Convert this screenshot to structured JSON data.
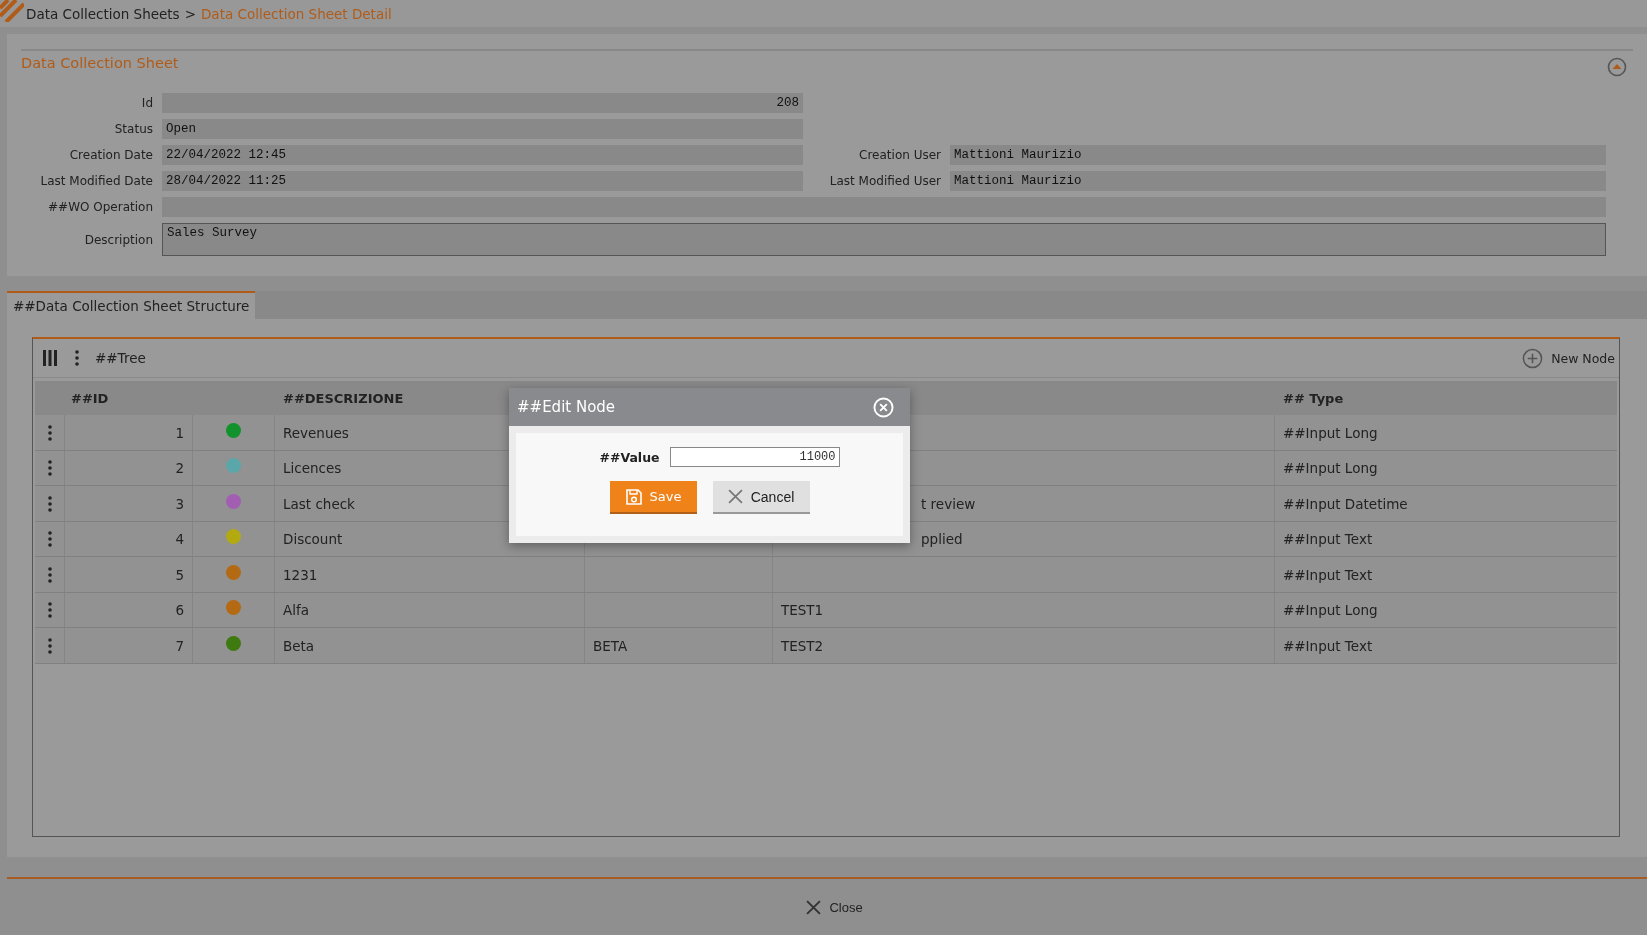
{
  "breadcrumb": [
    {
      "label": "Data Collection Sheets",
      "current": false
    },
    {
      "label": "Data Collection Sheet Detail",
      "current": true
    }
  ],
  "breadcrumb_separator": ">",
  "sheet": {
    "title": "Data Collection Sheet",
    "expanded": true,
    "rows": [
      {
        "left": {
          "label": "Id",
          "value": "208",
          "kind": "number"
        }
      },
      {
        "left": {
          "label": "Status",
          "value": "Open",
          "kind": "text"
        }
      },
      {
        "left": {
          "label": "Creation Date",
          "value": "22/04/2022 12:45",
          "kind": "text"
        },
        "right": {
          "label": "Creation User",
          "value": "Mattioni Maurizio",
          "kind": "text"
        }
      },
      {
        "left": {
          "label": "Last Modified Date",
          "value": "28/04/2022 11:25",
          "kind": "text"
        },
        "right": {
          "label": "Last Modified User",
          "value": "Mattioni Maurizio",
          "kind": "text"
        }
      },
      {
        "left": {
          "label": "##WO Operation",
          "kind": "wide"
        }
      },
      {
        "left": {
          "label": "Description",
          "value": "Sales Survey",
          "kind": "textarea"
        }
      }
    ]
  },
  "tabs": [
    {
      "label": "##Data Collection Sheet Structure",
      "selected": true
    }
  ],
  "tree": {
    "title": "##Tree",
    "new_node": "New Node",
    "columns": {
      "id": "##ID",
      "description": "##DESCRIZIONE",
      "type": "## Type"
    },
    "rows": [
      {
        "id": "1",
        "color": "#12922c",
        "description": "Revenues",
        "type": "##Input Long"
      },
      {
        "id": "2",
        "color": "#5aa6a8",
        "description": "Licences",
        "type": "##Input Long"
      },
      {
        "id": "3",
        "color": "#a25fb2",
        "description": "Last check",
        "column_5_end": "t review",
        "type": "##Input Datetime"
      },
      {
        "id": "4",
        "color": "#b2aa10",
        "description": "Discount",
        "column_5_end": "pplied",
        "type": "##Input Text"
      },
      {
        "id": "5",
        "color": "#b46a12",
        "description": "1231",
        "type": "##Input Text"
      },
      {
        "id": "6",
        "color": "#b46a12",
        "description": "Alfa",
        "column_5": "TEST1",
        "type": "##Input Long"
      },
      {
        "id": "7",
        "color": "#3f7a10",
        "description": "Beta",
        "column_4": "BETA",
        "column_5": "TEST2",
        "type": "##Input Text"
      }
    ]
  },
  "dialog": {
    "title": "##Edit Node",
    "label": "##Value",
    "value": "11000",
    "save": "Save",
    "cancel": "Cancel"
  },
  "footer": {
    "close": "Close"
  }
}
